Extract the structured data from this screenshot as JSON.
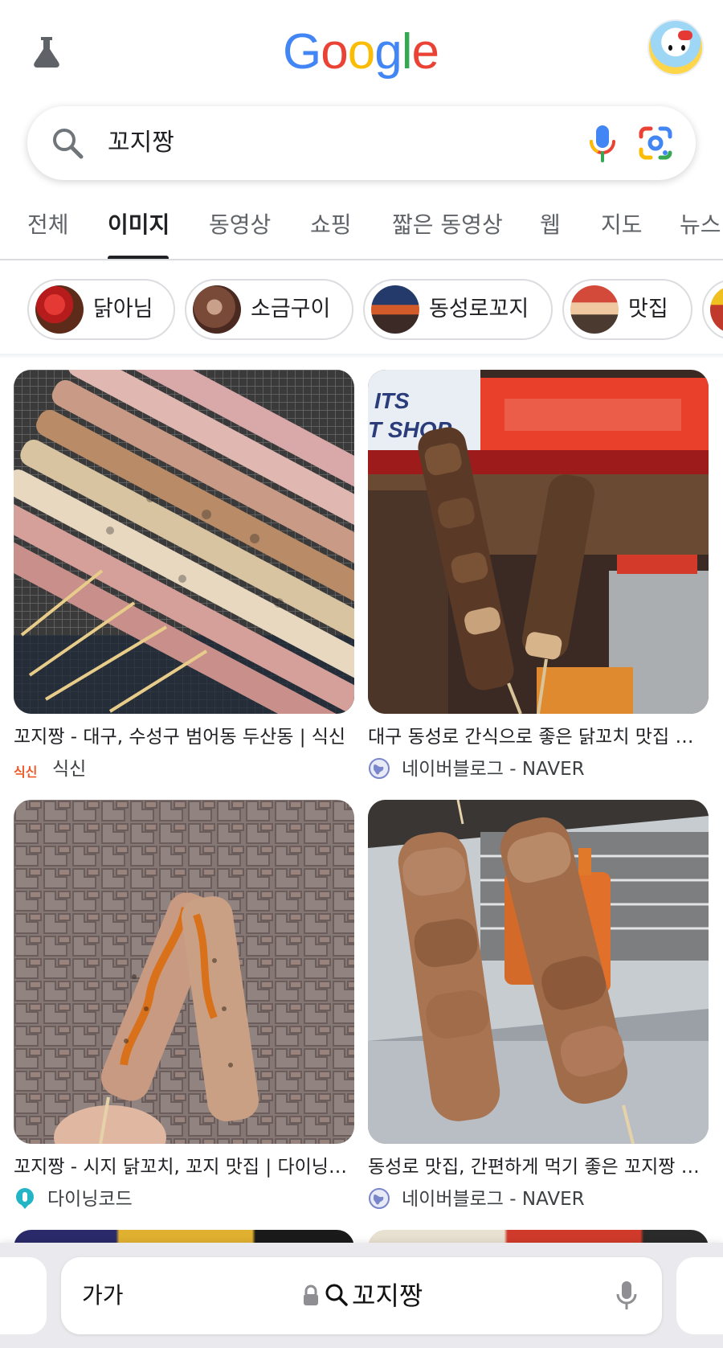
{
  "header": {
    "logo_letters": [
      "G",
      "o",
      "o",
      "g",
      "l",
      "e"
    ],
    "logo_colors": [
      "#4285F4",
      "#EA4335",
      "#FBBC05",
      "#4285F4",
      "#34A853",
      "#EA4335"
    ],
    "labs_icon": "flask-icon",
    "avatar_icon": "hello-kitty-avatar"
  },
  "search": {
    "query": "꼬지짱",
    "search_icon": "search-icon",
    "mic_icon": "mic-icon",
    "lens_icon": "google-lens-icon"
  },
  "tabs": [
    {
      "label": "전체"
    },
    {
      "label": "이미지"
    },
    {
      "label": "동영상"
    },
    {
      "label": "쇼핑"
    },
    {
      "label": "짧은 동영상"
    },
    {
      "label": "웹"
    },
    {
      "label": "지도"
    },
    {
      "label": "뉴스"
    }
  ],
  "active_tab": "이미지",
  "chips": [
    {
      "label": "닭아님"
    },
    {
      "label": "소금구이"
    },
    {
      "label": "동성로꼬지"
    },
    {
      "label": "맛집"
    }
  ],
  "results": [
    {
      "title": "꼬지짱 - 대구, 수성구 범어동 두산동 | 식신",
      "source": "식신",
      "favicon": "siksin-favicon",
      "favicon_text": "식신",
      "image": "grilled-chicken-skewers-on-grill"
    },
    {
      "title": "대구 동성로 간식으로 좋은 닭꼬치 맛집 꼬지짱",
      "source": "네이버블로그 - NAVER",
      "favicon": "globe-favicon",
      "image": "skewers-in-front-of-kkojijjang-sign"
    },
    {
      "title": "꼬지짱 - 시지 닭꼬치, 꼬지 맛집 | 다이닝코드",
      "source": "다이닝코드",
      "favicon": "diningcode-favicon",
      "image": "sauced-skewer-over-pavement"
    },
    {
      "title": "동성로 맛집, 간편하게 먹기 좋은 꼬지짱 닭꼬치",
      "source": "네이버블로그 - NAVER",
      "favicon": "globe-favicon",
      "image": "two-skewers-with-sauce-bottles"
    }
  ],
  "browser_bar": {
    "text_size_label": "가가",
    "url_text": "꼬지짱",
    "lock_icon": "lock-icon",
    "search_icon": "search-icon",
    "mic_icon": "mic-icon"
  }
}
